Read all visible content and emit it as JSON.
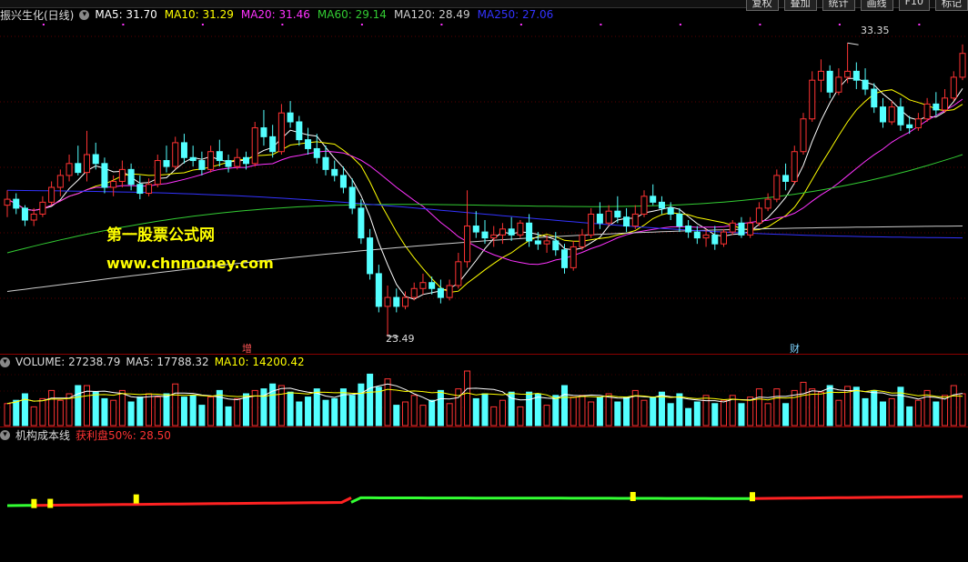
{
  "toolbar": {
    "items": [
      "复权",
      "叠加",
      "统计",
      "画线",
      "F10",
      "标记"
    ]
  },
  "main_panel": {
    "title": "振兴生化(日线)",
    "ma": [
      {
        "label": "MA5: 31.70",
        "color": "#ffffff"
      },
      {
        "label": "MA10: 31.29",
        "color": "#ffff00"
      },
      {
        "label": "MA20: 31.46",
        "color": "#ff33ff"
      },
      {
        "label": "MA60: 29.14",
        "color": "#33cc33"
      },
      {
        "label": "MA120: 28.49",
        "color": "#cccccc"
      },
      {
        "label": "MA250: 27.06",
        "color": "#3333ff"
      }
    ],
    "high_label": "33.35",
    "low_label": "23.49",
    "marker_zeng": "增",
    "marker_cai": "财"
  },
  "watermark": {
    "line1": "第一股票公式网",
    "line2": "www.chnmoney.com"
  },
  "volume_panel": {
    "title": "VOLUME: 27238.79",
    "ma5": "MA5: 17788.32",
    "ma10": "MA10: 14200.42"
  },
  "cost_panel": {
    "title": "机构成本线",
    "profit": "获利盘50%: 28.50"
  },
  "chart_data": {
    "type": "candlestick",
    "price_range": [
      23.0,
      34.0
    ],
    "high": 33.35,
    "low": 23.49,
    "colors": {
      "up": "#ff3333",
      "down": "#54ffff"
    },
    "candles": [
      [
        27.9,
        28.4,
        27.5,
        28.1
      ],
      [
        28.1,
        28.3,
        27.6,
        27.8
      ],
      [
        27.8,
        27.9,
        27.2,
        27.4
      ],
      [
        27.4,
        27.8,
        27.2,
        27.6
      ],
      [
        27.6,
        28.2,
        27.5,
        28.0
      ],
      [
        28.0,
        28.7,
        27.9,
        28.5
      ],
      [
        28.5,
        29.1,
        28.2,
        28.9
      ],
      [
        28.9,
        29.6,
        28.7,
        29.3
      ],
      [
        29.3,
        29.9,
        28.9,
        29.0
      ],
      [
        29.0,
        30.4,
        28.7,
        29.6
      ],
      [
        29.6,
        30.0,
        29.1,
        29.3
      ],
      [
        29.3,
        29.5,
        28.3,
        28.5
      ],
      [
        28.5,
        28.9,
        28.2,
        28.7
      ],
      [
        28.7,
        29.4,
        28.5,
        29.1
      ],
      [
        29.1,
        29.3,
        28.4,
        28.6
      ],
      [
        28.6,
        28.9,
        28.1,
        28.3
      ],
      [
        28.3,
        28.8,
        28.2,
        28.6
      ],
      [
        28.6,
        29.6,
        28.5,
        29.4
      ],
      [
        29.4,
        29.9,
        29.0,
        29.2
      ],
      [
        29.2,
        30.2,
        29.1,
        30.0
      ],
      [
        30.0,
        30.3,
        29.3,
        29.5
      ],
      [
        29.5,
        29.9,
        29.2,
        29.4
      ],
      [
        29.4,
        29.7,
        28.9,
        29.1
      ],
      [
        29.1,
        29.9,
        29.0,
        29.7
      ],
      [
        29.7,
        30.1,
        29.2,
        29.4
      ],
      [
        29.4,
        29.6,
        29.0,
        29.2
      ],
      [
        29.2,
        29.8,
        29.1,
        29.5
      ],
      [
        29.5,
        29.7,
        29.1,
        29.3
      ],
      [
        29.3,
        30.7,
        29.2,
        30.5
      ],
      [
        30.5,
        31.1,
        29.9,
        30.2
      ],
      [
        30.2,
        30.6,
        29.5,
        29.7
      ],
      [
        29.7,
        31.3,
        29.6,
        31.0
      ],
      [
        31.0,
        31.4,
        30.5,
        30.7
      ],
      [
        30.7,
        30.9,
        29.9,
        30.1
      ],
      [
        30.1,
        30.5,
        29.6,
        29.8
      ],
      [
        29.8,
        30.3,
        29.3,
        29.5
      ],
      [
        29.5,
        29.9,
        28.9,
        29.1
      ],
      [
        29.1,
        29.4,
        28.7,
        28.9
      ],
      [
        28.9,
        29.2,
        28.3,
        28.5
      ],
      [
        28.5,
        28.8,
        27.6,
        27.8
      ],
      [
        27.8,
        28.1,
        26.6,
        26.8
      ],
      [
        26.8,
        27.1,
        25.4,
        25.6
      ],
      [
        25.6,
        25.9,
        24.3,
        24.5
      ],
      [
        24.5,
        25.2,
        23.49,
        24.8
      ],
      [
        24.8,
        25.1,
        24.3,
        24.5
      ],
      [
        24.5,
        25.0,
        24.4,
        24.8
      ],
      [
        24.8,
        25.3,
        24.7,
        25.1
      ],
      [
        25.1,
        25.6,
        24.9,
        25.3
      ],
      [
        25.3,
        25.5,
        24.9,
        25.1
      ],
      [
        25.1,
        25.4,
        24.6,
        24.8
      ],
      [
        24.8,
        25.4,
        24.7,
        25.2
      ],
      [
        25.2,
        26.3,
        25.1,
        26.0
      ],
      [
        26.0,
        28.4,
        25.8,
        27.2
      ],
      [
        27.2,
        27.7,
        26.8,
        27.0
      ],
      [
        27.0,
        27.4,
        26.6,
        26.8
      ],
      [
        26.8,
        27.2,
        26.5,
        26.9
      ],
      [
        26.9,
        27.3,
        26.6,
        27.1
      ],
      [
        27.1,
        27.5,
        26.7,
        26.9
      ],
      [
        26.9,
        27.4,
        26.8,
        27.3
      ],
      [
        27.3,
        27.6,
        26.5,
        26.7
      ],
      [
        26.7,
        27.0,
        26.4,
        26.6
      ],
      [
        26.6,
        26.9,
        26.3,
        26.7
      ],
      [
        26.7,
        27.0,
        26.2,
        26.4
      ],
      [
        26.4,
        26.6,
        25.6,
        25.8
      ],
      [
        25.8,
        26.7,
        25.7,
        26.5
      ],
      [
        26.5,
        27.1,
        26.4,
        26.9
      ],
      [
        26.9,
        27.8,
        26.8,
        27.6
      ],
      [
        27.6,
        28.0,
        27.1,
        27.3
      ],
      [
        27.3,
        27.9,
        27.2,
        27.7
      ],
      [
        27.7,
        28.2,
        27.3,
        27.5
      ],
      [
        27.5,
        27.8,
        27.0,
        27.2
      ],
      [
        27.2,
        27.9,
        27.1,
        27.6
      ],
      [
        27.6,
        28.4,
        27.5,
        28.2
      ],
      [
        28.2,
        28.6,
        27.9,
        28.0
      ],
      [
        28.0,
        28.2,
        27.6,
        27.8
      ],
      [
        27.8,
        28.0,
        27.4,
        27.6
      ],
      [
        27.6,
        27.8,
        27.0,
        27.2
      ],
      [
        27.2,
        27.4,
        26.8,
        27.0
      ],
      [
        27.0,
        27.2,
        26.6,
        26.8
      ],
      [
        26.8,
        27.1,
        26.5,
        26.9
      ],
      [
        26.9,
        27.2,
        26.4,
        26.6
      ],
      [
        26.6,
        27.1,
        26.5,
        27.0
      ],
      [
        27.0,
        27.4,
        26.9,
        27.3
      ],
      [
        27.3,
        27.5,
        26.8,
        26.9
      ],
      [
        26.9,
        27.5,
        26.8,
        27.3
      ],
      [
        27.3,
        28.0,
        27.2,
        27.8
      ],
      [
        27.8,
        28.3,
        27.7,
        28.1
      ],
      [
        28.1,
        29.1,
        28.0,
        28.9
      ],
      [
        28.9,
        29.3,
        28.4,
        28.7
      ],
      [
        28.7,
        29.9,
        28.6,
        29.7
      ],
      [
        29.7,
        31.0,
        29.6,
        30.8
      ],
      [
        30.8,
        32.4,
        30.7,
        32.1
      ],
      [
        32.1,
        32.8,
        31.7,
        32.4
      ],
      [
        32.4,
        32.6,
        31.5,
        31.7
      ],
      [
        31.7,
        32.5,
        31.6,
        32.2
      ],
      [
        32.2,
        33.35,
        32.0,
        32.4
      ],
      [
        32.4,
        32.7,
        31.8,
        32.1
      ],
      [
        32.1,
        32.5,
        31.6,
        31.8
      ],
      [
        31.8,
        32.0,
        31.0,
        31.2
      ],
      [
        31.2,
        31.5,
        30.5,
        30.7
      ],
      [
        30.7,
        31.4,
        30.6,
        31.2
      ],
      [
        31.2,
        31.5,
        30.4,
        30.6
      ],
      [
        30.6,
        30.9,
        30.3,
        30.5
      ],
      [
        30.5,
        31.0,
        30.4,
        30.8
      ],
      [
        30.8,
        31.5,
        30.7,
        31.3
      ],
      [
        31.3,
        31.7,
        30.9,
        31.1
      ],
      [
        31.1,
        31.8,
        31.0,
        31.5
      ],
      [
        31.5,
        32.4,
        31.4,
        32.2
      ],
      [
        32.2,
        33.3,
        32.1,
        33.0
      ]
    ],
    "volume_max": 30000,
    "cost_line_value": 28.5
  }
}
